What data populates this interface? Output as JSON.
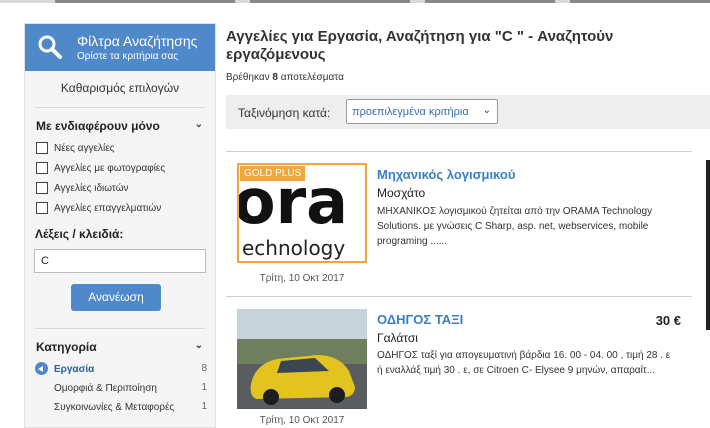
{
  "sidebar": {
    "header_title": "Φίλτρα Αναζήτησης",
    "header_sub": "Ορίστε τα κριτήρια σας",
    "clear_label": "Καθαρισμός επιλογών",
    "interest_title": "Με ενδιαφέρουν μόνο",
    "checkboxes": [
      "Νέες αγγελίες",
      "Αγγελίες με φωτογραφίες",
      "Αγγελίες ιδιωτών",
      "Αγγελίες επαγγελματιών"
    ],
    "keywords_title": "Λέξεις / κλειδιά:",
    "keywords_value": "C",
    "update_label": "Ανανέωση",
    "category_title": "Κατηγορία",
    "categories": [
      {
        "name": "Εργασία",
        "count": "8"
      },
      {
        "name": "Ομορφιά & Περιποίηση",
        "count": "1"
      },
      {
        "name": "Συγκοινωνίες & Μεταφορές",
        "count": "1"
      }
    ]
  },
  "main": {
    "title": "Αγγελίες για Εργασία, Αναζήτηση για \"C \" - Αναζητούν εργαζόμενους",
    "found_prefix": "Βρέθηκαν",
    "found_count": "8",
    "found_suffix": "αποτελέσματα",
    "sort_label": "Ταξινόμηση κατά:",
    "sort_value": "προεπιλεγμένα κριτήρια"
  },
  "listings": [
    {
      "badge": "GOLD PLUS",
      "logo_big": "ora",
      "logo_small": "echnology",
      "date": "Τρίτη, 10 Οκτ 2017",
      "title": "Μηχανικός λογισμικού",
      "location": "Μοσχάτο",
      "description": "ΜΗΧΑΝΙΚΟΣ λογισμικού ζητείται από την ORAMA Technology Solutions. με γνώσεις C Sharp, asp. net, webservices, mobile programing ......",
      "price": ""
    },
    {
      "date": "Τρίτη, 10 Οκτ 2017",
      "title": "ΟΔΗΓΟΣ ΤΑΞΙ",
      "location": "Γαλάτσι",
      "description": "ΟΔΗΓΟΣ ταξί για απογευματινή βάρδια 16. 00 - 04. 00 , τιμή 28 . ε ή εναλλάξ τιμή 30 . ε, σε Citroen C- Elysee 9 μηνών, απαραίτ...",
      "price": "30 €"
    }
  ],
  "colors": {
    "accent": "#4f89c9",
    "link": "#3a7fc4",
    "gold": "#f0a73d"
  }
}
